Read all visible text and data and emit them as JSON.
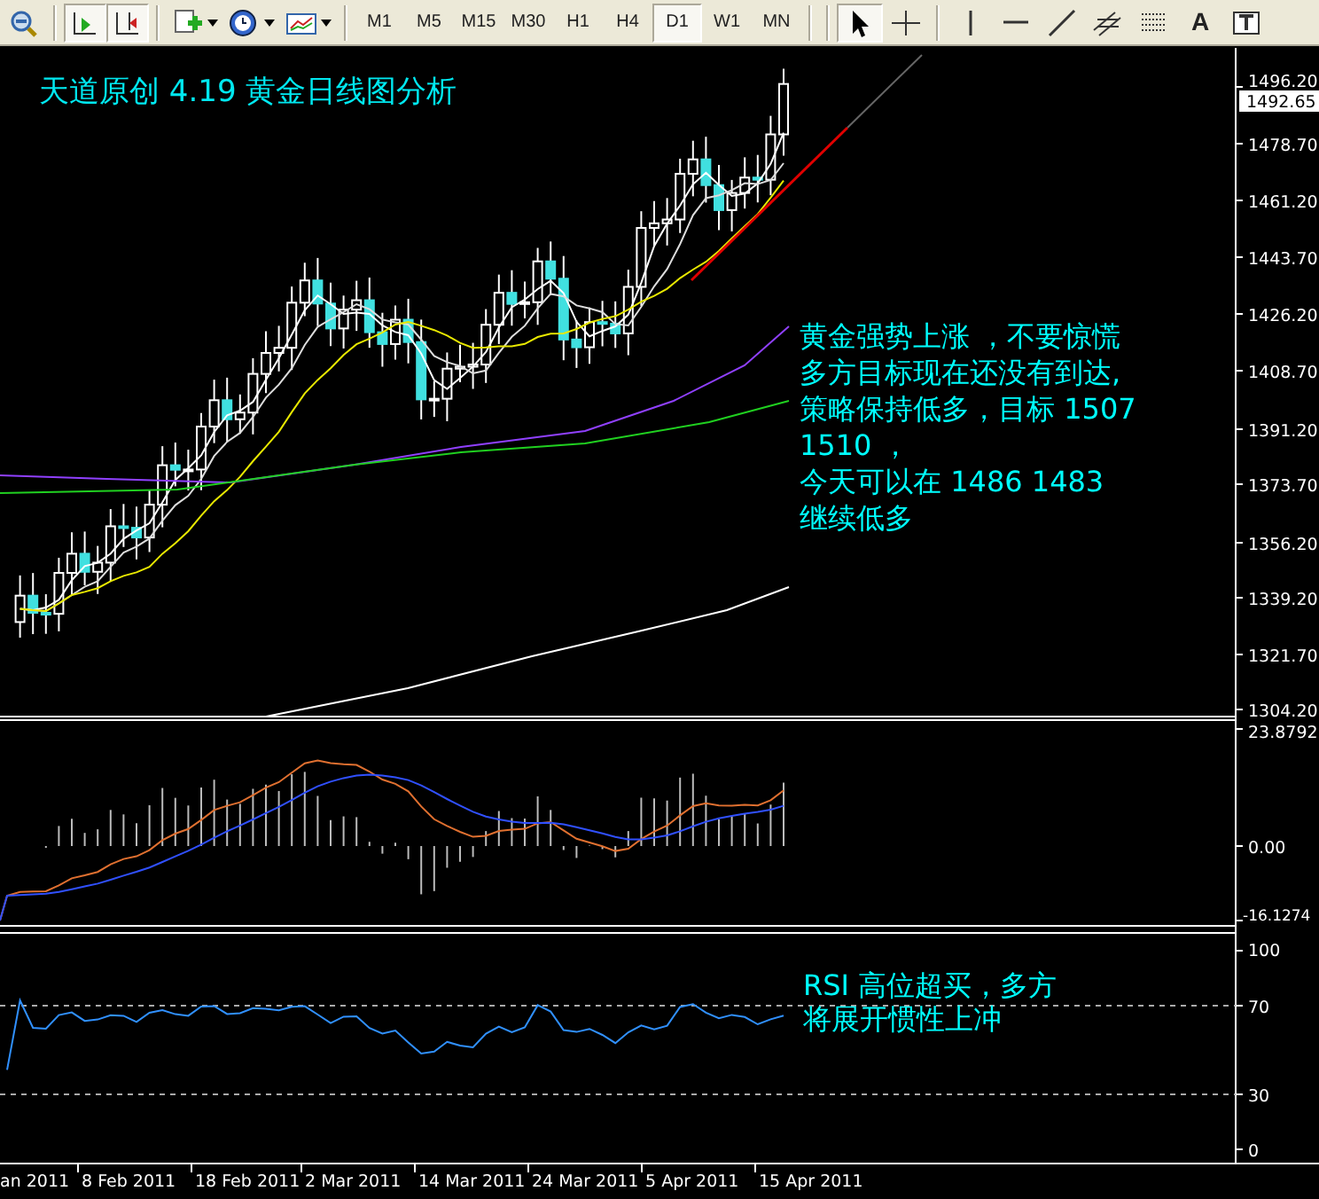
{
  "toolbar": {
    "buttons": [
      {
        "kind": "zoom-out"
      },
      {
        "kind": "autoscroll",
        "on": true
      },
      {
        "kind": "chart-shift",
        "on": true
      },
      {
        "kind": "new-chart"
      },
      {
        "kind": "periods"
      },
      {
        "kind": "templates"
      }
    ],
    "timeframes": [
      {
        "label": "M1",
        "selected": false
      },
      {
        "label": "M5",
        "selected": false
      },
      {
        "label": "M15",
        "selected": false
      },
      {
        "label": "M30",
        "selected": false
      },
      {
        "label": "H1",
        "selected": false
      },
      {
        "label": "H4",
        "selected": false
      },
      {
        "label": "D1",
        "selected": true
      },
      {
        "label": "W1",
        "selected": false
      },
      {
        "label": "MN",
        "selected": false
      }
    ],
    "tools": [
      {
        "kind": "cursor",
        "selected": true
      },
      {
        "kind": "crosshair",
        "selected": false
      },
      {
        "kind": "vline",
        "selected": false
      },
      {
        "kind": "hline",
        "selected": false
      },
      {
        "kind": "trendline",
        "selected": false
      },
      {
        "kind": "channel",
        "selected": false
      },
      {
        "kind": "fibo",
        "selected": false
      },
      {
        "kind": "text",
        "label": "A",
        "selected": false
      },
      {
        "kind": "label",
        "selected": false
      }
    ]
  },
  "main_panel": {
    "title": "天道原创 4.19 黄金日线图分析",
    "annotation": [
      "黄金强势上涨 ，不要惊慌",
      "多方目标现在还没有到达,",
      "策略保持低多，目标 1507",
      "1510  ，",
      "今天可以在 1486  1483",
      "继续低多"
    ],
    "price_labels": [
      "1496.20",
      "1478.70",
      "1461.20",
      "1443.70",
      "1426.20",
      "1408.70",
      "1391.20",
      "1373.70",
      "1356.20",
      "1339.20",
      "1321.70",
      "1304.20"
    ],
    "current_price": "1492.65"
  },
  "macd_panel": {
    "labels": [
      "23.8792",
      "0.00",
      "-16.1274"
    ]
  },
  "rsi_panel": {
    "annotation": [
      "RSI  高位超买，多方",
      "将展开惯性上冲"
    ],
    "labels": [
      "100",
      "70",
      "30",
      "0"
    ]
  },
  "date_axis": [
    "an 2011",
    "8 Feb 2011",
    "18 Feb 2011",
    "2 Mar 2011",
    "14 Mar 2011",
    "24 Mar 2011",
    "5 Apr 2011",
    "15 Apr 2011"
  ]
}
